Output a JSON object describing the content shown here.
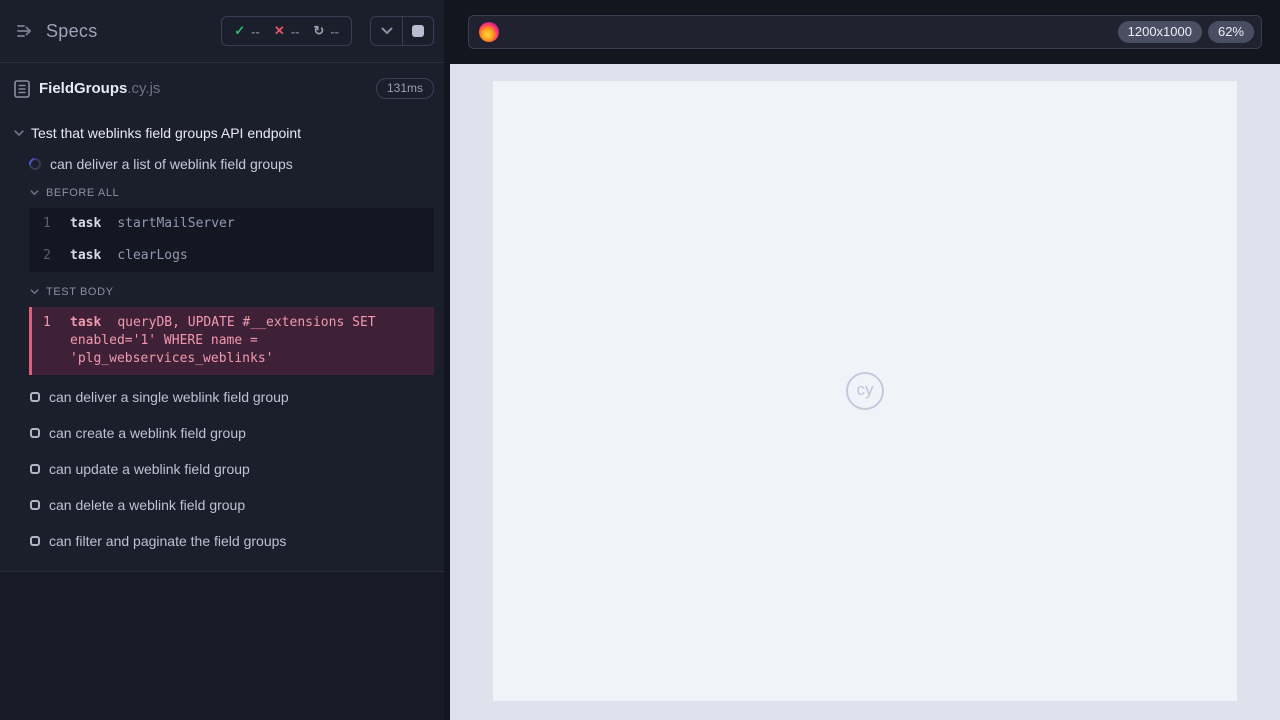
{
  "sidebar": {
    "title": "Specs",
    "stats": {
      "passed_count": "--",
      "failed_count": "--",
      "pending_count": "--"
    },
    "spec": {
      "name": "FieldGroups",
      "ext": ".cy.js",
      "duration": "131ms"
    },
    "suite_title": "Test that weblinks field groups API endpoint",
    "running_test": "can deliver a list of weblink field groups",
    "before_all": {
      "label": "BEFORE ALL",
      "commands": [
        {
          "n": "1",
          "method": "task",
          "message": "startMailServer"
        },
        {
          "n": "2",
          "method": "task",
          "message": "clearLogs"
        }
      ]
    },
    "test_body": {
      "label": "TEST BODY",
      "commands": [
        {
          "n": "1",
          "method": "task",
          "message": "queryDB, UPDATE #__extensions SET enabled='1' WHERE name = 'plg_webservices_weblinks'"
        }
      ]
    },
    "pending_tests": [
      "can deliver a single weblink field group",
      "can create a weblink field group",
      "can update a weblink field group",
      "can delete a weblink field group",
      "can filter and paginate the field groups"
    ]
  },
  "header": {
    "url_value": "",
    "viewport_size": "1200x1000",
    "zoom_level": "62%"
  },
  "main": {
    "watermark": "cy"
  },
  "colors": {
    "pass_green": "#2fbb6f",
    "fail_red": "#e4556a",
    "failed_command_bg": "#3e2136",
    "failed_command_border": "#e05f78",
    "failed_command_text": "#f299ae",
    "sidebar_bg": "#1b1e2b",
    "aut_frame_bg": "#f2f3f8",
    "viewport_bg": "#dfe2ec"
  }
}
